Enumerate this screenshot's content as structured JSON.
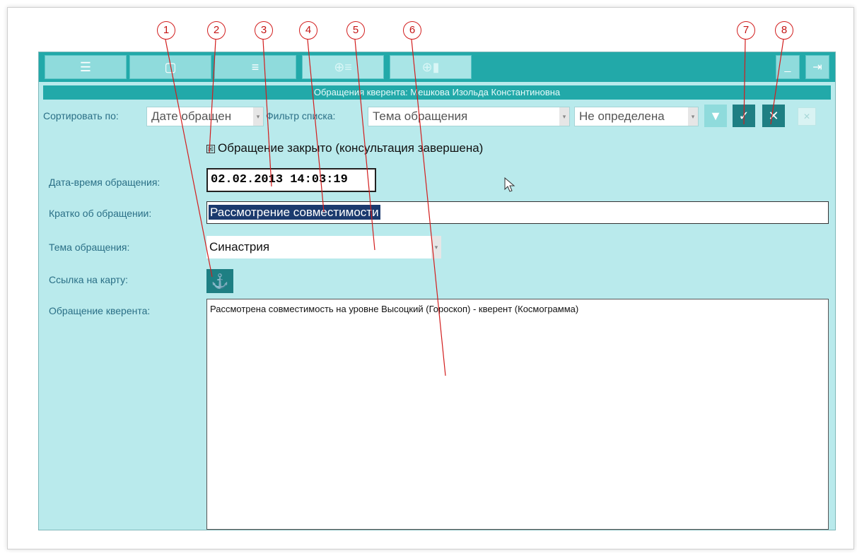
{
  "window": {
    "title": "Обращения кверента: Мешкова Изольда Константиновна"
  },
  "toolbar": {
    "buttons": [
      {
        "icon": "list-icon",
        "glyph": "☰"
      },
      {
        "icon": "document-icon",
        "glyph": "▢"
      },
      {
        "icon": "numbered-list-icon",
        "glyph": "≡"
      },
      {
        "icon": "add-list-icon",
        "glyph": "⊕≡"
      },
      {
        "icon": "add-database-icon",
        "glyph": "⊕▮"
      }
    ],
    "minimize_glyph": "_",
    "exit_glyph": "⇥"
  },
  "sort": {
    "label": "Сортировать по:",
    "value": "Дате обращен"
  },
  "filter": {
    "label": "Фильтр списка:",
    "field_value": "Тема обращения",
    "value": "Не определена"
  },
  "actions": {
    "filter_glyph": "▼",
    "apply_glyph": "✓",
    "cancel_glyph": "✕",
    "delete_glyph": "✕"
  },
  "form": {
    "closed_checkbox": {
      "checked": true,
      "mark": "☒",
      "label": "Обращение закрыто (консультация завершена)"
    },
    "datetime": {
      "label": "Дата-время обращения:",
      "value": "02.02.2013 14:03:19"
    },
    "summary": {
      "label": "Кратко об обращении:",
      "value": "Рассмотрение совместимости"
    },
    "topic": {
      "label": "Тема обращения:",
      "value": "Синастрия"
    },
    "chart_link": {
      "label": "Ссылка на карту:",
      "glyph": "⚓"
    },
    "request": {
      "label": "Обращение кверента:",
      "value": "Рассмотрена совместимость на уровне Высоцкий (Гороскоп) - кверент (Космограмма)"
    }
  },
  "callouts": [
    "1",
    "2",
    "3",
    "4",
    "5",
    "6",
    "7",
    "8"
  ],
  "colors": {
    "toolbar": "#22a9a9",
    "window_bg": "#b9eaec",
    "selection": "#1b3a6e",
    "callout": "#d21d1d"
  }
}
